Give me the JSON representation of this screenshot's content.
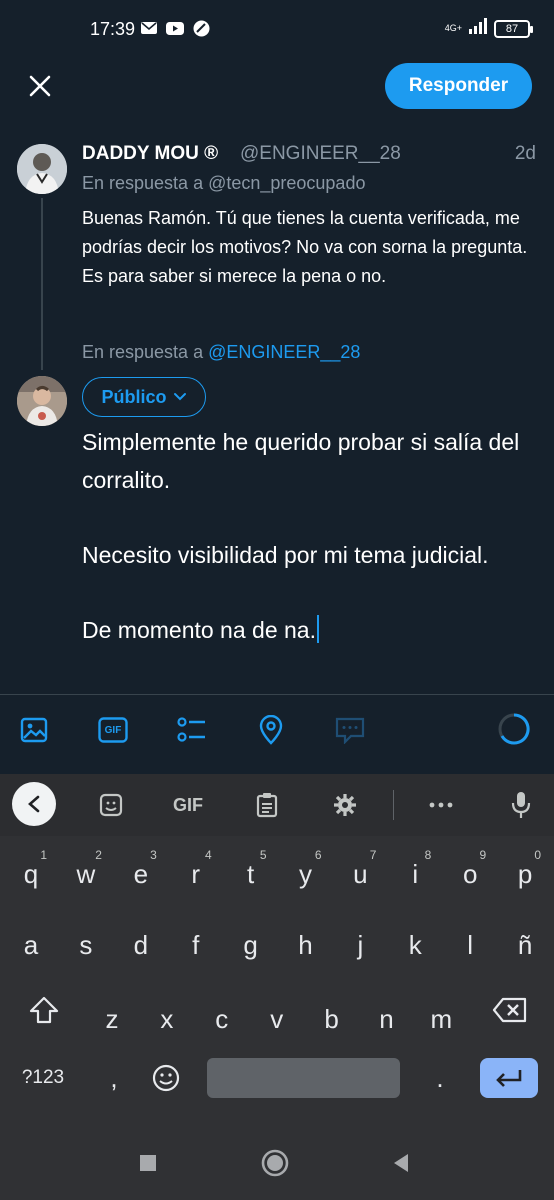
{
  "status_bar": {
    "time": "17:39",
    "network": "4G+",
    "battery": "87",
    "left_icons": [
      "mail-icon",
      "youtube-icon",
      "app-icon"
    ],
    "right_icons": [
      "signal-icon",
      "battery-icon"
    ]
  },
  "header": {
    "close_icon": "close-icon",
    "reply_label": "Responder"
  },
  "original_tweet": {
    "display_name": "DADDY MOU ®",
    "handle": "@ENGINEER__28",
    "time": "2d",
    "replying_to": "En respuesta a @tecn_preocupado",
    "body": "Buenas Ramón. Tú que tienes la cuenta verificada, me podrías decir los motivos? No va con sorna la pregunta.  Es para saber si merece la pena o no."
  },
  "compose": {
    "replying_prefix": "En respuesta a ",
    "replying_mention": "@ENGINEER__28",
    "audience_label": "Público",
    "text": "Simplemente he querido probar si salía del corralito.\n\nNecesito visibilidad por mi tema judicial.\n\nDe momento na de na."
  },
  "toolbar": {
    "icons": [
      "image-icon",
      "gif-icon",
      "poll-icon",
      "location-icon",
      "thread-icon",
      "character-progress-icon"
    ],
    "gif_label": "GIF"
  },
  "keyboard": {
    "suggestion_tools": [
      "back-icon",
      "sticker-icon",
      "gif-icon",
      "clipboard-icon",
      "settings-icon",
      "more-icon",
      "mic-icon"
    ],
    "gif_label": "GIF",
    "row1": [
      {
        "key": "q",
        "hint": "1"
      },
      {
        "key": "w",
        "hint": "2"
      },
      {
        "key": "e",
        "hint": "3"
      },
      {
        "key": "r",
        "hint": "4"
      },
      {
        "key": "t",
        "hint": "5"
      },
      {
        "key": "y",
        "hint": "6"
      },
      {
        "key": "u",
        "hint": "7"
      },
      {
        "key": "i",
        "hint": "8"
      },
      {
        "key": "o",
        "hint": "9"
      },
      {
        "key": "p",
        "hint": "0"
      }
    ],
    "row2": [
      "a",
      "s",
      "d",
      "f",
      "g",
      "h",
      "j",
      "k",
      "l",
      "ñ"
    ],
    "row3": [
      "z",
      "x",
      "c",
      "v",
      "b",
      "n",
      "m"
    ],
    "symbols_label": "?123",
    "comma": ",",
    "period": ".",
    "accent_color": "#8ab4f8"
  },
  "colors": {
    "background": "#15202b",
    "twitter_blue": "#1d9bf0",
    "muted": "#8b98a5"
  }
}
